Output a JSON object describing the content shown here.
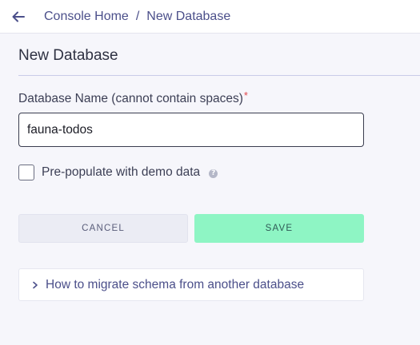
{
  "header": {
    "breadcrumb": {
      "home": "Console Home",
      "separator": "/",
      "current": "New Database"
    }
  },
  "form": {
    "title": "New Database",
    "name_label": "Database Name (cannot contain spaces)",
    "required_marker": "*",
    "name_value": "fauna-todos",
    "demo_data_label": "Pre-populate with demo data",
    "demo_data_checked": false,
    "help_icon_glyph": "?",
    "cancel_label": "CANCEL",
    "save_label": "SAVE",
    "migrate_label": "How to migrate schema from another database"
  },
  "colors": {
    "accent_link": "#4b4f8a",
    "save_button": "#8ef5c4",
    "required": "#e0474c"
  },
  "icons": {
    "back": "arrow-left-icon",
    "help": "question-circle-icon",
    "accordion": "chevron-right-icon"
  }
}
